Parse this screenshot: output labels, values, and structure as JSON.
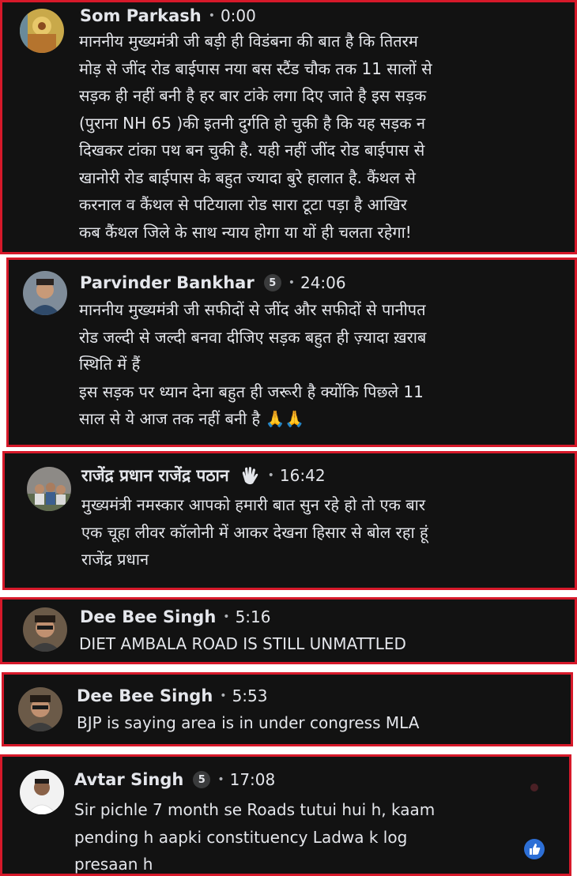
{
  "comments": [
    {
      "name": "Som Parkash",
      "time": "0:00",
      "lines": [
        "माननीय मुख्यमंत्री जी बड़ी ही विडंबना की बात है कि तितरम",
        "मोड़ से जींद रोड बाईपास नया बस स्टैंड चौक तक 11 सालों से",
        "सड़क ही नहीं बनी है हर बार टांके लगा दिए जाते है इस सड़क",
        "(पुराना NH 65 )की इतनी दुर्गति हो चुकी है कि यह सड़क न",
        "दिखकर टांका पथ बन चुकी है. यही नहीं जींद रोड बाईपास से",
        "खानोरी रोड बाईपास के बहुत ज्यादा बुरे हालात है. कैंथल से",
        "करनाल व कैंथल से पटियाला रोड सारा टूटा पड़ा है  आखिर",
        "कब कैंथल जिले के साथ न्याय होगा या यों ही चलता रहेगा!"
      ]
    },
    {
      "name": "Parvinder Bankhar",
      "badge": "5",
      "time": "24:06",
      "lines": [
        "माननीय मुख्यमंत्री जी सफीदों से जींद और सफीदों से पानीपत",
        "रोड जल्दी से जल्दी बनवा दीजिए सड़क बहुत ही ज़्यादा ख़राब",
        "स्थिति में हैं",
        "इस सड़क पर ध्यान देना बहुत ही जरूरी है क्योंकि पिछले 11",
        "साल से ये आज तक नहीं बनी है"
      ],
      "emoji": "🙏🙏"
    },
    {
      "name": "राजेंद्र प्रधान राजेंद्र पठान",
      "icon": "wave-hand-icon",
      "time": "16:42",
      "lines": [
        "मुख्यमंत्री नमस्कार आपको हमारी बात सुन रहे हो तो एक बार",
        "एक चूहा लीवर कॉलोनी में आकर देखना हिसार से बोल रहा हूं",
        "राजेंद्र प्रधान"
      ]
    },
    {
      "name": "Dee Bee Singh",
      "time": "5:16",
      "lines": [
        "DIET AMBALA ROAD IS STILL UNMATTLED"
      ]
    },
    {
      "name": "Dee Bee Singh",
      "time": "5:53",
      "lines": [
        "BJP is saying area is in under congress MLA"
      ]
    },
    {
      "name": "Avtar Singh",
      "badge": "5",
      "time": "17:08",
      "lines": [
        "Sir pichle 7 month se Roads tutui hui h, kaam",
        "pending h aapki constituency Ladwa k log",
        "presaan h"
      ],
      "reaction_icon": "like-icon"
    }
  ],
  "separator": "•",
  "colors": {
    "card_bg": "#121212",
    "border": "#d6192a",
    "text": "#e4e6eb",
    "meta": "#b0b3b8"
  }
}
